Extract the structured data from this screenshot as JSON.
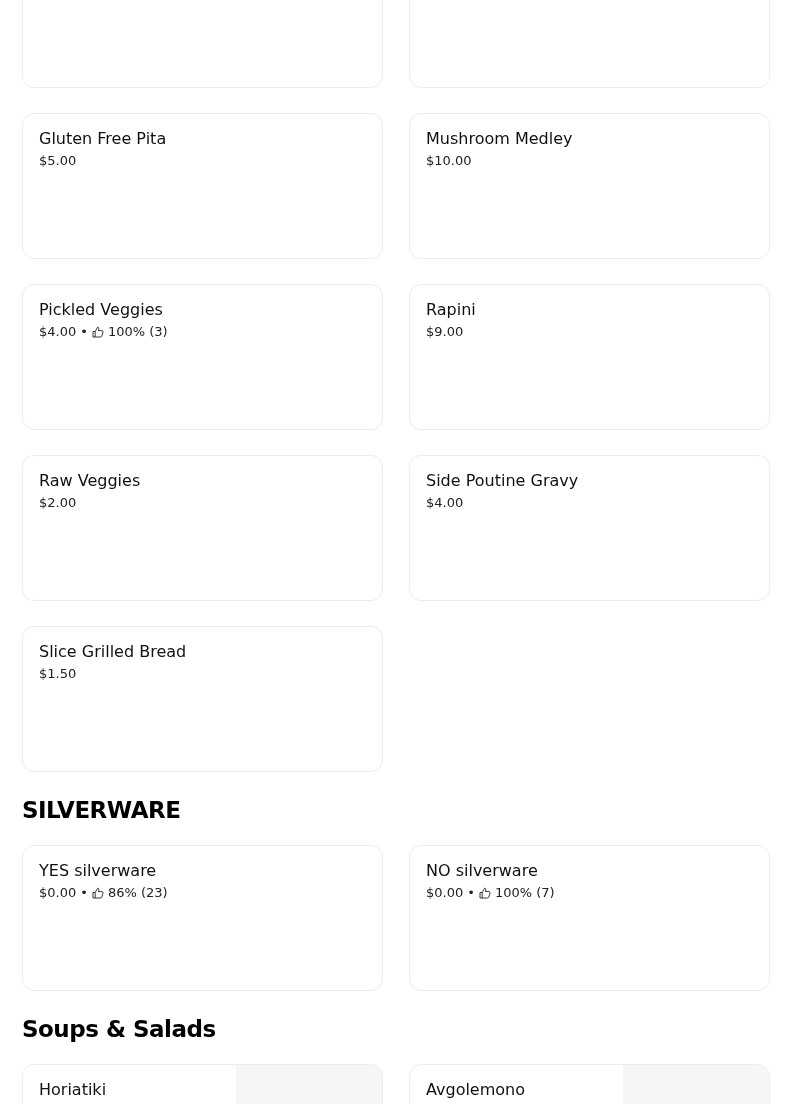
{
  "sections": [
    {
      "items": [
        {
          "kind": "blank"
        },
        {
          "kind": "blank"
        },
        {
          "kind": "item",
          "name": "Gluten Free Pita",
          "price": "$5.00"
        },
        {
          "kind": "item",
          "name": "Mushroom Medley",
          "price": "$10.00"
        },
        {
          "kind": "item",
          "name": "Pickled Veggies",
          "price": "$4.00",
          "separator": "•",
          "rating": "100% (3)"
        },
        {
          "kind": "item",
          "name": "Rapini",
          "price": "$9.00"
        },
        {
          "kind": "item",
          "name": "Raw Veggies",
          "price": "$2.00"
        },
        {
          "kind": "item",
          "name": "Side Poutine Gravy",
          "price": "$4.00"
        },
        {
          "kind": "item",
          "name": "Slice Grilled Bread",
          "price": "$1.50"
        }
      ]
    },
    {
      "title": "SILVERWARE",
      "items": [
        {
          "kind": "item",
          "name": "YES silverware",
          "price": "$0.00",
          "separator": "•",
          "rating": "86% (23)"
        },
        {
          "kind": "item",
          "name": "NO silverware",
          "price": "$0.00",
          "separator": "•",
          "rating": "100% (7)"
        }
      ]
    },
    {
      "title": "Soups & Salads",
      "items": [
        {
          "kind": "photo",
          "name": "Horiatiki"
        },
        {
          "kind": "photo",
          "name": "Avgolemono"
        }
      ]
    }
  ]
}
